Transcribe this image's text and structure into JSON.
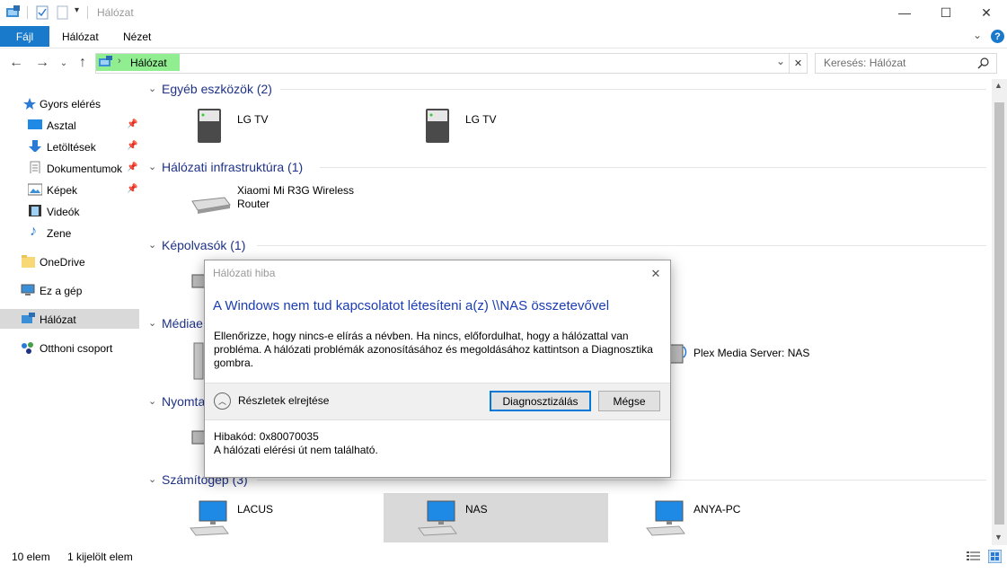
{
  "window": {
    "title": "Hálózat",
    "minimize_glyph": "—",
    "maximize_glyph": "☐",
    "close_glyph": "✕"
  },
  "ribbon": {
    "tabs": [
      "Fájl",
      "Hálózat",
      "Nézet"
    ],
    "help_glyph": "?"
  },
  "address": {
    "path": "Hálózat",
    "search_placeholder": "Keresés: Hálózat"
  },
  "sidebar": {
    "items": [
      {
        "label": "Gyors elérés",
        "icon": "star-icon"
      },
      {
        "label": "Asztal",
        "icon": "desktop-icon",
        "pinned": true
      },
      {
        "label": "Letöltések",
        "icon": "download-icon",
        "pinned": true
      },
      {
        "label": "Dokumentumok",
        "icon": "document-icon",
        "pinned": true
      },
      {
        "label": "Képek",
        "icon": "pictures-icon",
        "pinned": true
      },
      {
        "label": "Videók",
        "icon": "video-icon"
      },
      {
        "label": "Zene",
        "icon": "music-icon"
      },
      {
        "label": "OneDrive",
        "icon": "folder-icon"
      },
      {
        "label": "Ez a gép",
        "icon": "computer-icon"
      },
      {
        "label": "Hálózat",
        "icon": "network-icon",
        "selected": true
      },
      {
        "label": "Otthoni csoport",
        "icon": "homegroup-icon"
      }
    ]
  },
  "groups": [
    {
      "title": "Egyéb eszközök (2)",
      "items": [
        "LG TV",
        "LG TV"
      ]
    },
    {
      "title": "Hálózati infrastruktúra (1)",
      "items": [
        "Xiaomi Mi R3G Wireless",
        "Router"
      ]
    },
    {
      "title": "Képolvasók (1)"
    },
    {
      "title": "Médiae",
      "items": [
        "Plex Media Server: NAS"
      ]
    },
    {
      "title": "Nyomta"
    },
    {
      "title": "Számítógép (3)",
      "items": [
        "LACUS",
        "NAS",
        "ANYA-PC"
      ]
    }
  ],
  "dialog": {
    "title": "Hálózati hiba",
    "heading": "A Windows nem tud kapcsolatot létesíteni a(z) \\\\NAS összetevővel",
    "body_line1": "Ellenőrizze, hogy nincs-e elírás a névben. Ha nincs, előfordulhat, hogy a hálózattal van",
    "body_line2": "probléma. A hálózati problémák azonosításához és megoldásához kattintson a Diagnosztika",
    "body_line3": "gombra.",
    "details_toggle": "Részletek elrejtése",
    "diagnose_button": "Diagnosztizálás",
    "cancel_button": "Mégse",
    "error_code": "Hibakód: 0x80070035",
    "error_message": "A hálózati elérési út nem található."
  },
  "status": {
    "count": "10 elem",
    "selected": "1 kijelölt elem"
  },
  "colors": {
    "accent": "#1979ca",
    "group_title": "#1e3287",
    "address_highlight": "#90ee90",
    "dialog_heading": "#1a3cb4"
  }
}
